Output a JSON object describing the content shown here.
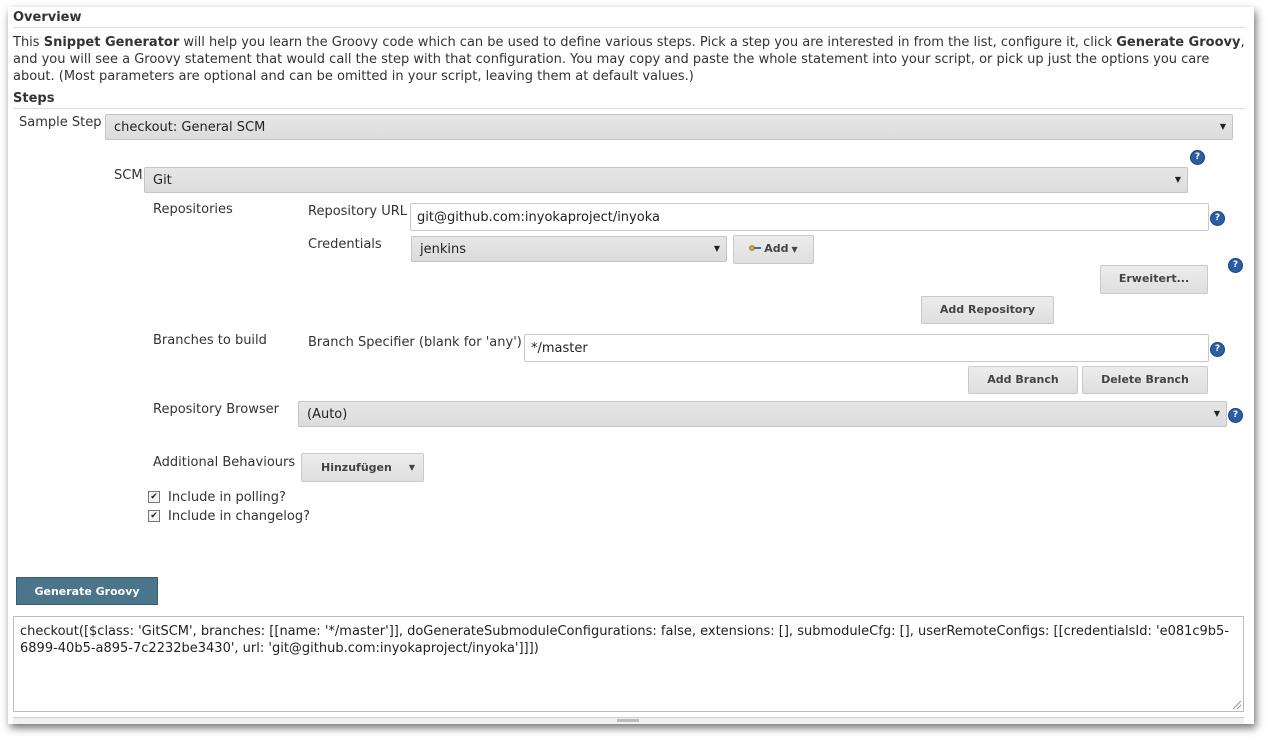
{
  "overview": {
    "title": "Overview",
    "desc_p1": "This ",
    "desc_b1": "Snippet Generator",
    "desc_p2": " will help you learn the Groovy code which can be used to define various steps. Pick a step you are interested in from the list, configure it, click ",
    "desc_b2": "Generate Groovy",
    "desc_p3": ", and you will see a Groovy statement that would call the step with that configuration. You may copy and paste the whole statement into your script, or pick up just the options you care about. (Most parameters are optional and can be omitted in your script, leaving them at default values.)"
  },
  "steps": {
    "title": "Steps",
    "sample_step_label": "Sample Step",
    "sample_step_value": "checkout: General SCM"
  },
  "scm": {
    "label": "SCM",
    "value": "Git",
    "repositories_label": "Repositories",
    "repo_url_label": "Repository URL",
    "repo_url_value": "git@github.com:inyokaproject/inyoka",
    "credentials_label": "Credentials",
    "credentials_value": "jenkins",
    "add_label": "Add",
    "advanced_label": "Erweitert...",
    "add_repository_label": "Add Repository",
    "branches_label": "Branches to build",
    "branch_specifier_label": "Branch Specifier (blank for 'any')",
    "branch_specifier_value": "*/master",
    "add_branch_label": "Add Branch",
    "delete_branch_label": "Delete Branch",
    "repo_browser_label": "Repository Browser",
    "repo_browser_value": "(Auto)",
    "additional_behaviours_label": "Additional Behaviours",
    "hinzufuegen_label": "Hinzufügen",
    "include_polling_label": "Include in polling?",
    "include_changelog_label": "Include in changelog?"
  },
  "generate": {
    "button_label": "Generate Groovy",
    "output": "checkout([$class: 'GitSCM', branches: [[name: '*/master']], doGenerateSubmoduleConfigurations: false, extensions: [], submoduleCfg: [], userRemoteConfigs: [[credentialsId: 'e081c9b5-6899-40b5-a895-7c2232be3430', url: 'git@github.com:inyokaproject/inyoka']]])"
  },
  "icons": {
    "help": "help-icon",
    "dropdown": "chevron-down-icon",
    "key": "key-icon",
    "checkbox": "checkbox-checked-icon"
  },
  "colors": {
    "generate_button": "#4b758b",
    "help_icon": "#2a5fa6"
  }
}
